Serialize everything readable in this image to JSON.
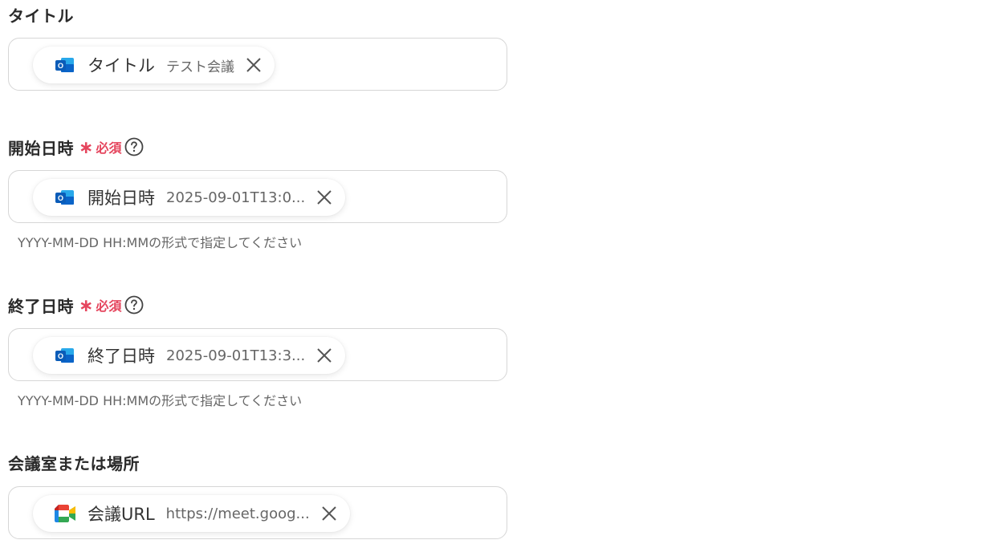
{
  "form": {
    "fields": [
      {
        "label": "タイトル",
        "required": false,
        "chip": {
          "name": "タイトル",
          "value": "テスト会議",
          "source_icon": "outlook-icon"
        }
      },
      {
        "label": "開始日時",
        "required": true,
        "required_text": "必須",
        "chip": {
          "name": "開始日時",
          "value": "2025-09-01T13:0...",
          "source_icon": "outlook-icon"
        },
        "hint": "YYYY-MM-DD HH:MMの形式で指定してください"
      },
      {
        "label": "終了日時",
        "required": true,
        "required_text": "必須",
        "chip": {
          "name": "終了日時",
          "value": "2025-09-01T13:3...",
          "source_icon": "outlook-icon"
        },
        "hint": "YYYY-MM-DD HH:MMの形式で指定してください"
      },
      {
        "label": "会議室または場所",
        "required": false,
        "chip": {
          "name": "会議URL",
          "value": "https://meet.goog...",
          "source_icon": "google-meet-icon"
        }
      }
    ]
  },
  "colors": {
    "required": "#e5455d",
    "outlook_blue": "#0a64c8",
    "border": "#d6d6d6"
  }
}
